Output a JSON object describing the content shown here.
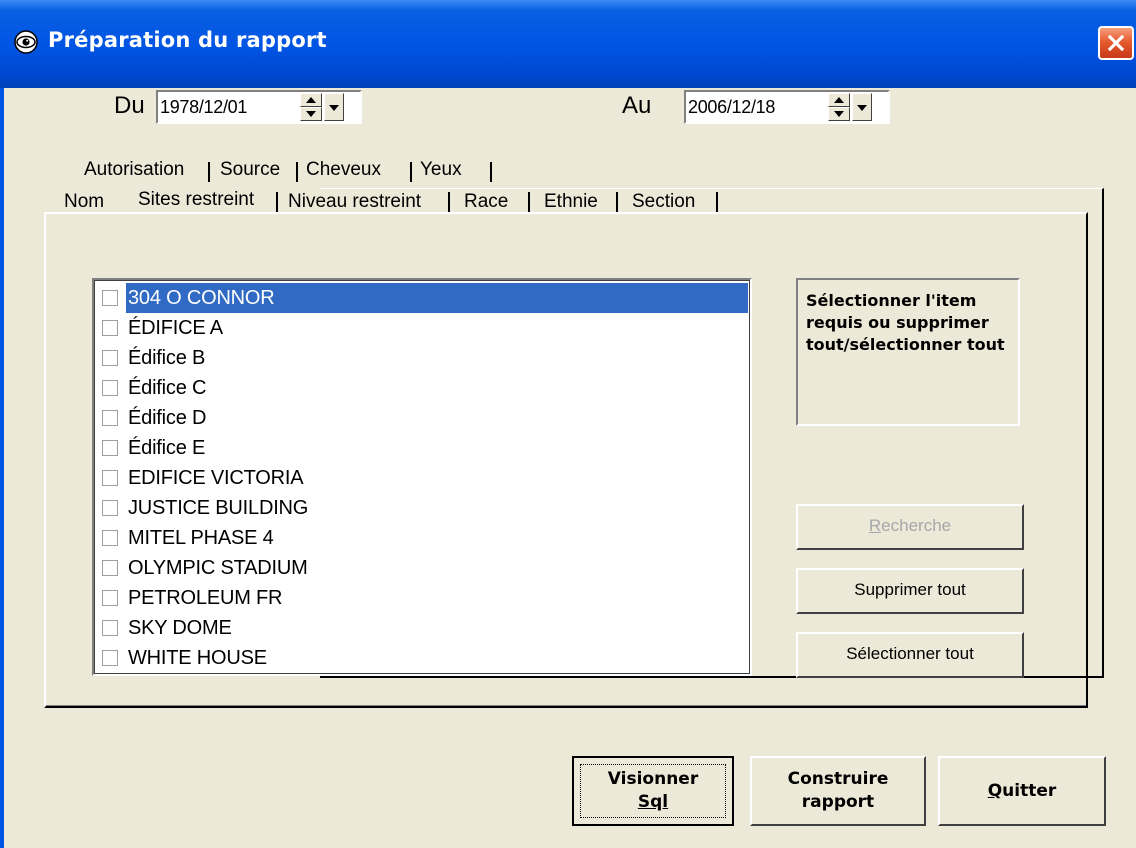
{
  "window": {
    "title": "Préparation du rapport",
    "accent": "#0054E3"
  },
  "dates": {
    "from_label": "Du",
    "from_value": "1978/12/01",
    "to_label": "Au",
    "to_value": "2006/12/18"
  },
  "tabs": {
    "row_back": [
      "Autorisation",
      "Source",
      "Cheveux",
      "Yeux"
    ],
    "row_front": [
      "Nom",
      "Sites restreint",
      "Niveau restreint",
      "Race",
      "Ethnie",
      "Section"
    ],
    "active": "Sites restreint"
  },
  "sites_list": {
    "items": [
      {
        "label": "304 O CONNOR",
        "checked": false,
        "selected": true
      },
      {
        "label": "ÉDIFICE A",
        "checked": false,
        "selected": false
      },
      {
        "label": "Édifice B",
        "checked": false,
        "selected": false
      },
      {
        "label": "Édifice C",
        "checked": false,
        "selected": false
      },
      {
        "label": "Édifice D",
        "checked": false,
        "selected": false
      },
      {
        "label": "Édifice E",
        "checked": false,
        "selected": false
      },
      {
        "label": "EDIFICE VICTORIA",
        "checked": false,
        "selected": false
      },
      {
        "label": "JUSTICE BUILDING",
        "checked": false,
        "selected": false
      },
      {
        "label": "MITEL PHASE 4",
        "checked": false,
        "selected": false
      },
      {
        "label": "OLYMPIC STADIUM",
        "checked": false,
        "selected": false
      },
      {
        "label": "PETROLEUM FR",
        "checked": false,
        "selected": false
      },
      {
        "label": "SKY DOME",
        "checked": false,
        "selected": false
      },
      {
        "label": "WHITE HOUSE",
        "checked": false,
        "selected": false
      }
    ],
    "selection_color": "#316AC5"
  },
  "info": {
    "text": "Sélectionner l'item requis ou supprimer tout/sélectionner tout"
  },
  "side_buttons": {
    "search": {
      "label": "Recherche",
      "mnemonic": "R",
      "rest": "echerche",
      "enabled": false
    },
    "clear_all": {
      "label": "Supprimer tout"
    },
    "select_all": {
      "label": "Sélectionner tout"
    }
  },
  "bottom_buttons": {
    "preview": {
      "line1": "Visionner",
      "line2": "Sql"
    },
    "build": {
      "line1": "Construire",
      "line2": "rapport"
    },
    "quit": {
      "label": "Quitter",
      "mnemonic": "Q",
      "rest": "uitter"
    }
  },
  "icons": {
    "title": "eye-icon",
    "close": "close-icon"
  }
}
